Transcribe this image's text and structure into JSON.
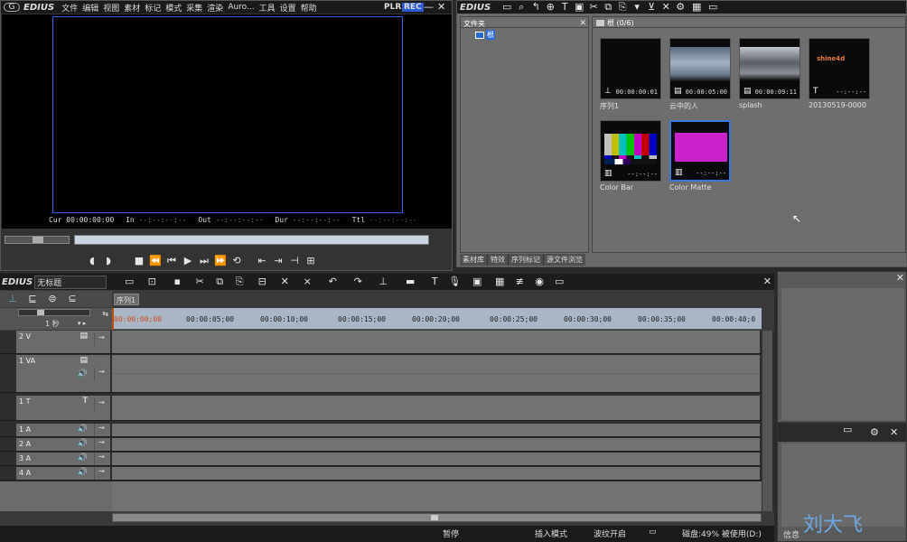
{
  "player": {
    "logo": "EDIUS",
    "menu": [
      "文件",
      "编辑",
      "视图",
      "素材",
      "标记",
      "模式",
      "采集",
      "渲染",
      "Auro...",
      "工具",
      "设置",
      "帮助"
    ],
    "plr": "PLR",
    "rec": "REC",
    "cur_label": "Cur",
    "cur_value": "00:00:00:00",
    "in_label": "In",
    "in_value": "--:--:--:--",
    "out_label": "Out",
    "out_value": "--:--:--:--",
    "dur_label": "Dur",
    "dur_value": "--:--:--:--",
    "ttl_label": "Ttl",
    "ttl_value": "--:--:--:--"
  },
  "bin": {
    "logo": "EDIUS",
    "folder_title": "文件夹",
    "root_label": "根",
    "path": "根 (0/6)",
    "clips": [
      {
        "name": "序列1",
        "tc": "00:00:00:01"
      },
      {
        "name": "云中的人",
        "tc": "00:00:05:00"
      },
      {
        "name": "splash",
        "tc": "00:00:09:11"
      },
      {
        "name": "20130519-0000",
        "tc": "--:--:--",
        "thumb_text": "shine4d"
      },
      {
        "name": "Color Bar",
        "tc": "--:--:--"
      },
      {
        "name": "Color Matte",
        "tc": "--:--:--"
      }
    ],
    "tabs": [
      "素材库",
      "特效",
      "序列标记",
      "源文件浏览"
    ],
    "colors": {
      "matte": "#cc22cc",
      "selected_border": "#3a78d8"
    }
  },
  "timeline": {
    "logo": "EDIUS",
    "project_name": "无标题",
    "sequence_tab": "序列1",
    "zoom": "1 秒",
    "ruler": [
      "00:00:00;00",
      "00:00:05;00",
      "00:00:10;00",
      "00:00:15;00",
      "00:00:20;00",
      "00:00:25;00",
      "00:00:30;00",
      "00:00:35;00",
      "00:00:40;0"
    ],
    "tracks": [
      "2 V",
      "1 VA",
      "1 T",
      "1 A",
      "2 A",
      "3 A",
      "4 A"
    ]
  },
  "right_panel": {
    "info_tab": "信息",
    "watermark": "刘大飞"
  },
  "status": {
    "pause": "暂停",
    "insert_mode": "插入模式",
    "ripple": "波纹开启",
    "disk": "磁盘:49% 被使用(D:)"
  }
}
